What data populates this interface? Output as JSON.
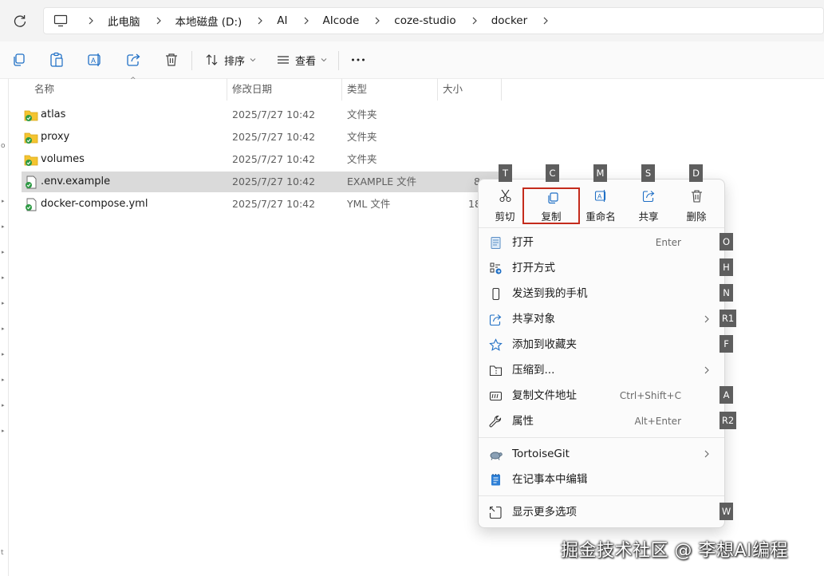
{
  "breadcrumb": [
    "此电脑",
    "本地磁盘 (D:)",
    "AI",
    "AIcode",
    "coze-studio",
    "docker"
  ],
  "toolbar": {
    "sort_label": "排序",
    "view_label": "查看"
  },
  "columns": {
    "name": "名称",
    "modified": "修改日期",
    "type": "类型",
    "size": "大小"
  },
  "files": [
    {
      "name": "atlas",
      "date": "2025/7/27 10:42",
      "type": "文件夹",
      "size": "",
      "icon": "folder-icon"
    },
    {
      "name": "proxy",
      "date": "2025/7/27 10:42",
      "type": "文件夹",
      "size": "",
      "icon": "folder-icon"
    },
    {
      "name": "volumes",
      "date": "2025/7/27 10:42",
      "type": "文件夹",
      "size": "",
      "icon": "folder-icon"
    },
    {
      "name": ".env.example",
      "date": "2025/7/27 10:42",
      "type": "EXAMPLE 文件",
      "size": "8",
      "icon": "file-icon",
      "selected": true
    },
    {
      "name": "docker-compose.yml",
      "date": "2025/7/27 10:42",
      "type": "YML 文件",
      "size": "18",
      "icon": "file-icon"
    }
  ],
  "left_marks": [
    "o",
    "t"
  ],
  "context_menu": {
    "quick_actions": [
      {
        "label": "剪切",
        "key": "T",
        "icon": "scissors-icon"
      },
      {
        "label": "复制",
        "key": "C",
        "icon": "copy-icon"
      },
      {
        "label": "重命名",
        "key": "M",
        "icon": "rename-icon"
      },
      {
        "label": "共享",
        "key": "S",
        "icon": "share-icon"
      },
      {
        "label": "删除",
        "key": "D",
        "icon": "trash-icon"
      }
    ],
    "items": [
      {
        "label": "打开",
        "shortcut": "Enter",
        "key": "O"
      },
      {
        "label": "打开方式",
        "shortcut": "",
        "key": "H"
      },
      {
        "label": "发送到我的手机",
        "shortcut": "",
        "key": "N"
      },
      {
        "label": "共享对象",
        "shortcut": "",
        "key": "R1"
      },
      {
        "label": "添加到收藏夹",
        "shortcut": "",
        "key": "F"
      },
      {
        "label": "压缩到...",
        "shortcut": "",
        "key": ""
      },
      {
        "label": "复制文件地址",
        "shortcut": "Ctrl+Shift+C",
        "key": "A"
      },
      {
        "label": "属性",
        "shortcut": "Alt+Enter",
        "key": "R2"
      },
      {
        "label": "TortoiseGit",
        "shortcut": "",
        "key": ""
      },
      {
        "label": "在记事本中编辑",
        "shortcut": "",
        "key": ""
      },
      {
        "label": "显示更多选项",
        "shortcut": "",
        "key": "W"
      }
    ]
  },
  "watermark": "掘金技术社区 @ 李想AI编程",
  "colors": {
    "folder": "#f4c430",
    "git_check": "#2e9a44",
    "highlight": "#c42b1c",
    "selection": "#dadada",
    "accent": "#1f6fc5"
  }
}
